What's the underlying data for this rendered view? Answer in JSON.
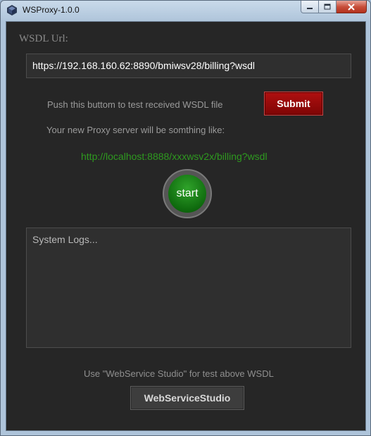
{
  "window": {
    "title": "WSProxy-1.0.0",
    "icons": {
      "app": "cube-icon",
      "minimize": "minimize-icon",
      "maximize": "maximize-icon",
      "close": "close-icon"
    }
  },
  "form": {
    "wsdl_label": "WSDL Url:",
    "wsdl_url_value": "https://192.168.160.62:8890/bmiwsv28/billing?wsdl",
    "push_text": "Push this buttom to test received WSDL file",
    "submit_label": "Submit",
    "proxy_label": "Your new Proxy server will be somthing like:",
    "proxy_url": "http://localhost:8888/xxxwsv2x/billing?wsdl",
    "start_label": "start"
  },
  "logs": {
    "placeholder": "System Logs..."
  },
  "footer": {
    "hint": "Use \"WebService Studio\" for test above WSDL",
    "button_label": "WebServiceStudio"
  },
  "colors": {
    "background": "#262626",
    "submit": "#9b0a0a",
    "start": "#1a7d17",
    "proxy_url": "#2e9a1f"
  }
}
